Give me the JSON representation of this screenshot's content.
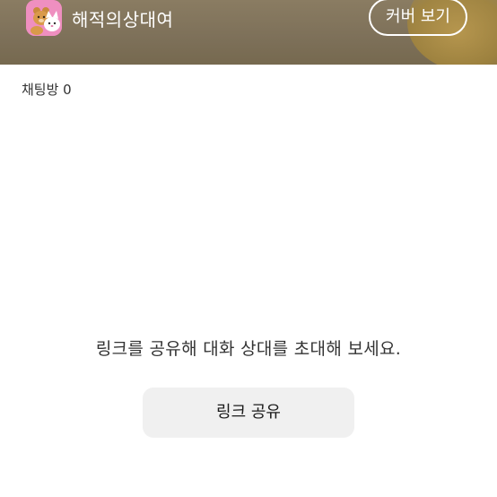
{
  "header": {
    "title": "해적의상대여",
    "cover_button_label": "커버 보기",
    "avatar_icon": "cat-bear-avatar-icon",
    "background_color": "#7d7059"
  },
  "rooms": {
    "count_label": "채팅방 0"
  },
  "empty_state": {
    "message": "링크를 공유해 대화 상대를 초대해 보세요.",
    "share_button_label": "링크 공유"
  }
}
